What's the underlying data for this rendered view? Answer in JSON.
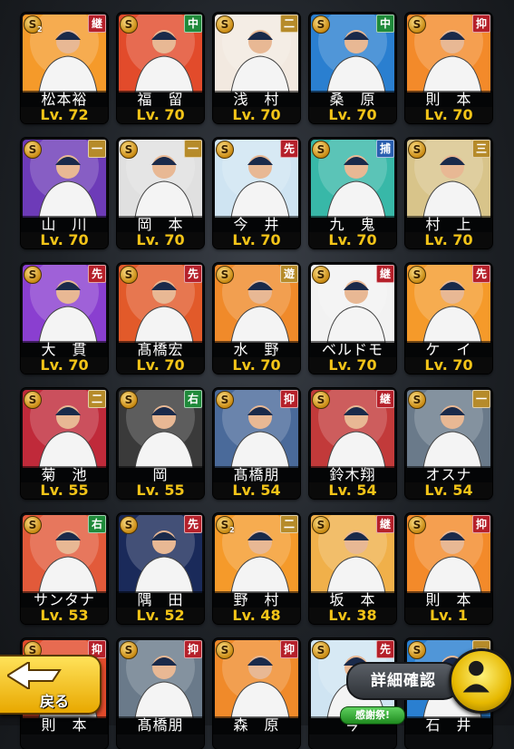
{
  "cards": [
    {
      "name": "松本裕",
      "level": "Lv. 72",
      "position": "継",
      "pos_color": "#b5202a",
      "art": "#f59a2a",
      "stars": "2"
    },
    {
      "name": "福　留",
      "level": "Lv. 70",
      "position": "中",
      "pos_color": "#1f8a3a",
      "art": "#e24b2b",
      "stars": ""
    },
    {
      "name": "浅　村",
      "level": "Lv. 70",
      "position": "二",
      "pos_color": "#b68b2a",
      "art": "#f2e9e0",
      "stars": ""
    },
    {
      "name": "桑　原",
      "level": "Lv. 70",
      "position": "中",
      "pos_color": "#1f8a3a",
      "art": "#2a7fd0",
      "stars": ""
    },
    {
      "name": "則　本",
      "level": "Lv. 70",
      "position": "抑",
      "pos_color": "#b5202a",
      "art": "#f38a2a",
      "stars": ""
    },
    {
      "name": "山　川",
      "level": "Lv. 70",
      "position": "一",
      "pos_color": "#b68b2a",
      "art": "#6d3bb8",
      "stars": ""
    },
    {
      "name": "岡　本",
      "level": "Lv. 70",
      "position": "一",
      "pos_color": "#b68b2a",
      "art": "#e0e0e0",
      "stars": ""
    },
    {
      "name": "今　井",
      "level": "Lv. 70",
      "position": "先",
      "pos_color": "#b5202a",
      "art": "#cfe4f2",
      "stars": ""
    },
    {
      "name": "九　鬼",
      "level": "Lv. 70",
      "position": "捕",
      "pos_color": "#2a5fb0",
      "art": "#38b8a8",
      "stars": ""
    },
    {
      "name": "村　上",
      "level": "Lv. 70",
      "position": "三",
      "pos_color": "#b68b2a",
      "art": "#d8c48a",
      "stars": ""
    },
    {
      "name": "大　貫",
      "level": "Lv. 70",
      "position": "先",
      "pos_color": "#b5202a",
      "art": "#8a3fd0",
      "stars": ""
    },
    {
      "name": "髙橋宏",
      "level": "Lv. 70",
      "position": "先",
      "pos_color": "#b5202a",
      "art": "#e25a2a",
      "stars": ""
    },
    {
      "name": "水　野",
      "level": "Lv. 70",
      "position": "遊",
      "pos_color": "#b68b2a",
      "art": "#f08a2a",
      "stars": ""
    },
    {
      "name": "ベルドモ",
      "level": "Lv. 70",
      "position": "継",
      "pos_color": "#b5202a",
      "art": "#f2f2f2",
      "stars": ""
    },
    {
      "name": "ケ　イ",
      "level": "Lv. 70",
      "position": "先",
      "pos_color": "#b5202a",
      "art": "#f59a2a",
      "stars": ""
    },
    {
      "name": "菊　池",
      "level": "Lv. 55",
      "position": "二",
      "pos_color": "#b68b2a",
      "art": "#c02a3a",
      "stars": ""
    },
    {
      "name": "岡",
      "level": "Lv. 55",
      "position": "右",
      "pos_color": "#1f8a3a",
      "art": "#3a3a3a",
      "stars": ""
    },
    {
      "name": "髙橋朋",
      "level": "Lv. 54",
      "position": "抑",
      "pos_color": "#b5202a",
      "art": "#4a6a9a",
      "stars": ""
    },
    {
      "name": "鈴木翔",
      "level": "Lv. 54",
      "position": "継",
      "pos_color": "#b5202a",
      "art": "#c23a3a",
      "stars": ""
    },
    {
      "name": "オスナ",
      "level": "Lv. 54",
      "position": "一",
      "pos_color": "#b68b2a",
      "art": "#6a7a8a",
      "stars": ""
    },
    {
      "name": "サンタナ",
      "level": "Lv. 53",
      "position": "右",
      "pos_color": "#1f8a3a",
      "art": "#e25a3a",
      "stars": ""
    },
    {
      "name": "隅　田",
      "level": "Lv. 52",
      "position": "先",
      "pos_color": "#b5202a",
      "art": "#1a2a5a",
      "stars": ""
    },
    {
      "name": "野　村",
      "level": "Lv. 48",
      "position": "二",
      "pos_color": "#b68b2a",
      "art": "#f59a2a",
      "stars": "2"
    },
    {
      "name": "坂　本",
      "level": "Lv. 38",
      "position": "継",
      "pos_color": "#b5202a",
      "art": "#f0b04a",
      "stars": ""
    },
    {
      "name": "則　本",
      "level": "Lv. 1",
      "position": "抑",
      "pos_color": "#b5202a",
      "art": "#f38a2a",
      "stars": ""
    },
    {
      "name": "則　本",
      "level": "",
      "position": "抑",
      "pos_color": "#b5202a",
      "art": "#e24b2b",
      "stars": ""
    },
    {
      "name": "髙橋朋",
      "level": "",
      "position": "抑",
      "pos_color": "#b5202a",
      "art": "#6a7a8a",
      "stars": ""
    },
    {
      "name": "森　原",
      "level": "",
      "position": "抑",
      "pos_color": "#b5202a",
      "art": "#f08a2a",
      "stars": ""
    },
    {
      "name": "今",
      "level": "",
      "position": "先",
      "pos_color": "#b5202a",
      "art": "#cfe4f2",
      "stars": ""
    },
    {
      "name": "石　井",
      "level": "",
      "position": "一",
      "pos_color": "#b68b2a",
      "art": "#2a7fd0",
      "stars": ""
    }
  ],
  "badge_letter": "S",
  "back_label": "戻る",
  "detail_label": "詳細確認",
  "event_label": "感謝祭!"
}
